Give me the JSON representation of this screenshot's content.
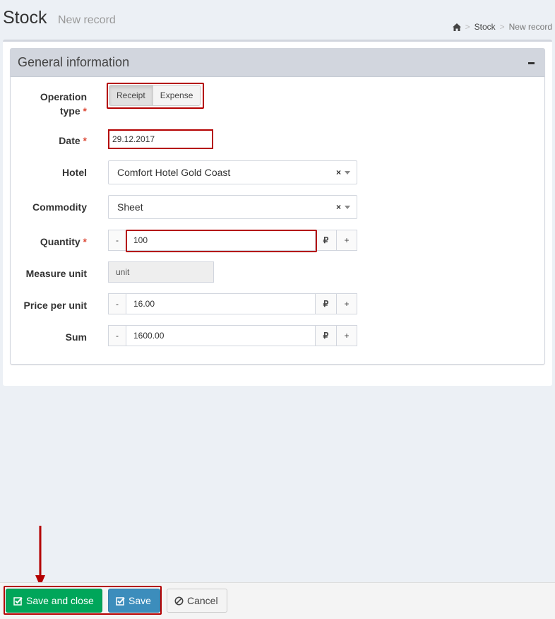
{
  "header": {
    "title": "Stock",
    "subtitle": "New record",
    "breadcrumb": {
      "home_icon": "home-icon",
      "stock": "Stock",
      "current": "New record"
    }
  },
  "panel": {
    "title": "General information",
    "collapse_icon": "minus-icon"
  },
  "form": {
    "operation_type": {
      "label_line1": "Operation",
      "label_line2": "type",
      "required": "*",
      "options": [
        "Receipt",
        "Expense"
      ],
      "selected": "Receipt"
    },
    "date": {
      "label": "Date",
      "required": "*",
      "value": "29.12.2017"
    },
    "hotel": {
      "label": "Hotel",
      "value": "Comfort Hotel Gold Coast",
      "clear": "×"
    },
    "commodity": {
      "label": "Commodity",
      "value": "Sheet",
      "clear": "×"
    },
    "quantity": {
      "label": "Quantity",
      "required": "*",
      "minus": "-",
      "value": "100",
      "currency": "₽",
      "plus": "+"
    },
    "measure_unit": {
      "label": "Measure unit",
      "value": "unit"
    },
    "price_per_unit": {
      "label": "Price per unit",
      "minus": "-",
      "value": "16.00",
      "currency": "₽",
      "plus": "+"
    },
    "sum": {
      "label": "Sum",
      "minus": "-",
      "value": "1600.00",
      "currency": "₽",
      "plus": "+"
    }
  },
  "footer": {
    "save_and_close": "Save and close",
    "save": "Save",
    "cancel": "Cancel"
  },
  "colors": {
    "success": "#00a65a",
    "primary": "#3c8dbc",
    "highlight": "#b40000",
    "required": "#dd4b39"
  }
}
